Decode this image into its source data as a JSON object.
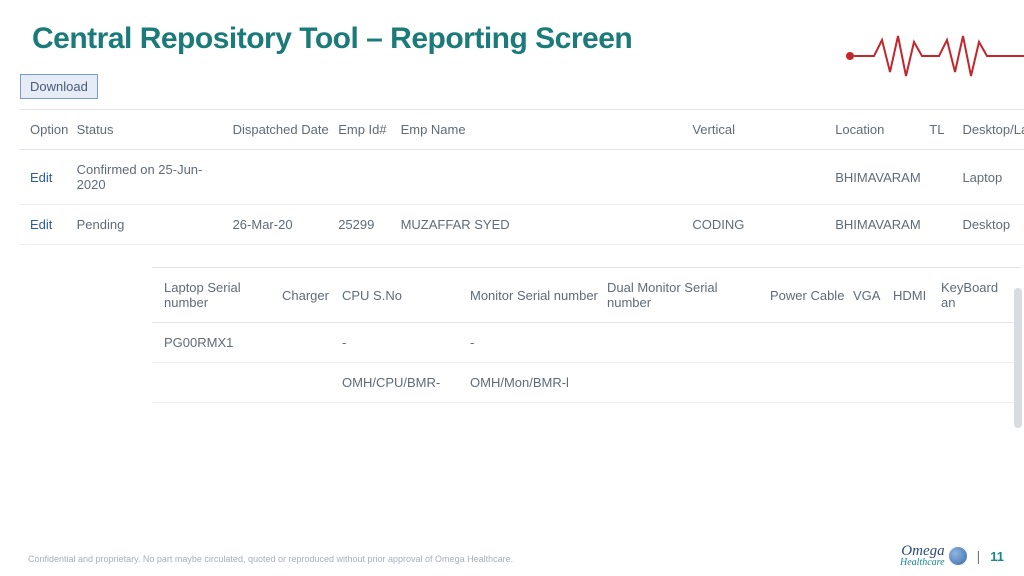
{
  "title": "Central Repository Tool – Reporting Screen",
  "download_label": "Download",
  "table1": {
    "headers": [
      "Option",
      "Status",
      "Dispatched Date",
      "Emp Id#",
      "Emp Name",
      "Vertical",
      "Location",
      "TL",
      "Desktop/Lap"
    ],
    "rows": [
      {
        "option": "Edit",
        "status": "Confirmed on 25-Jun-2020",
        "dispatched": "",
        "empid": "",
        "empname": "",
        "vertical": "",
        "location": "BHIMAVARAM",
        "tl": "",
        "device": "Laptop"
      },
      {
        "option": "Edit",
        "status": "Pending",
        "dispatched": "26-Mar-20",
        "empid": "25299",
        "empname": "MUZAFFAR SYED",
        "vertical": "CODING",
        "location": "BHIMAVARAM",
        "tl": "",
        "device": "Desktop"
      }
    ]
  },
  "table2": {
    "headers": [
      "Laptop Serial number",
      "Charger",
      "CPU S.No",
      "Monitor Serial number",
      "Dual Monitor Serial number",
      "Power Cable",
      "VGA",
      "HDMI",
      "KeyBoard an"
    ],
    "rows": [
      {
        "laptop": "PG00RMX1",
        "charger": "",
        "cpu": "-",
        "monitor": "-",
        "dual": "",
        "power": "",
        "vga": "",
        "hdmi": "",
        "keyboard": ""
      },
      {
        "laptop": "",
        "charger": "",
        "cpu": "OMH/CPU/BMR-",
        "monitor": "OMH/Mon/BMR-l",
        "dual": "",
        "power": "",
        "vga": "",
        "hdmi": "",
        "keyboard": ""
      }
    ]
  },
  "footer": "Confidential and proprietary. No part maybe circulated, quoted or reproduced without prior approval of Omega Healthcare.",
  "logo": {
    "brand": "Omega",
    "sub": "Healthcare"
  },
  "page_number": "11"
}
